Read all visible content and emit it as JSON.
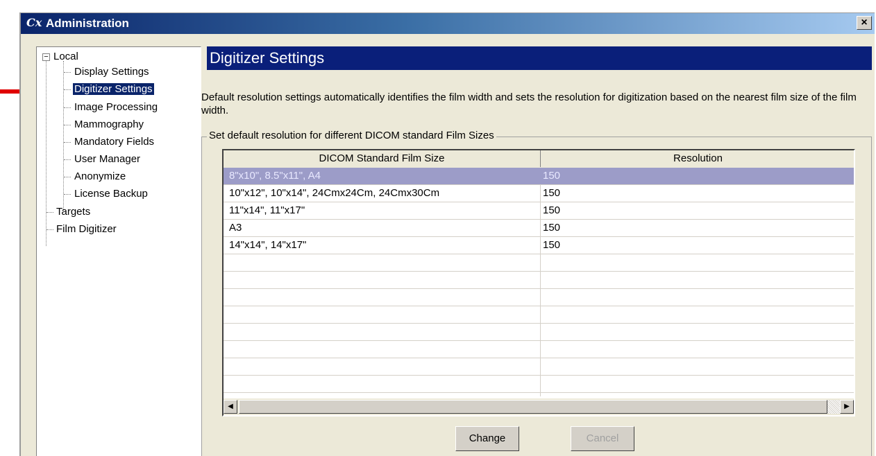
{
  "window": {
    "title": "Administration",
    "icon": "cx-icon",
    "close_label": "×"
  },
  "tree": {
    "root": "Local",
    "expander": "−",
    "children": [
      "Display Settings",
      "Digitizer Settings",
      "Image Processing",
      "Mammography",
      "Mandatory Fields",
      "User Manager",
      "Anonymize",
      "License Backup"
    ],
    "others": [
      "Targets",
      "Film Digitizer"
    ],
    "selected": "Digitizer Settings"
  },
  "panel": {
    "title": "Digitizer Settings",
    "description": "Default resolution settings automatically identifies the film width and sets the resolution for digitization based on the nearest film size of the film width.",
    "group_label": "Set default resolution for different DICOM standard Film Sizes"
  },
  "grid": {
    "columns": [
      "DICOM Standard Film Size",
      "Resolution"
    ],
    "rows": [
      {
        "size": "8\"x10\", 8.5\"x11\", A4",
        "resolution": "150"
      },
      {
        "size": "10\"x12\", 10\"x14\", 24Cmx24Cm, 24Cmx30Cm",
        "resolution": "150"
      },
      {
        "size": "11\"x14\", 11\"x17\"",
        "resolution": "150"
      },
      {
        "size": "A3",
        "resolution": "150"
      },
      {
        "size": "14\"x14\", 14\"x17\"",
        "resolution": "150"
      }
    ],
    "selected_row": 0,
    "scroll_left": "◀",
    "scroll_right": "▶"
  },
  "buttons": {
    "change": "Change",
    "cancel": "Cancel"
  },
  "colors": {
    "title_gradient_start": "#0a246a",
    "panel_header": "#0a1f7a",
    "selection": "#9c9cc8",
    "annotation_arrow": "#e00000"
  }
}
